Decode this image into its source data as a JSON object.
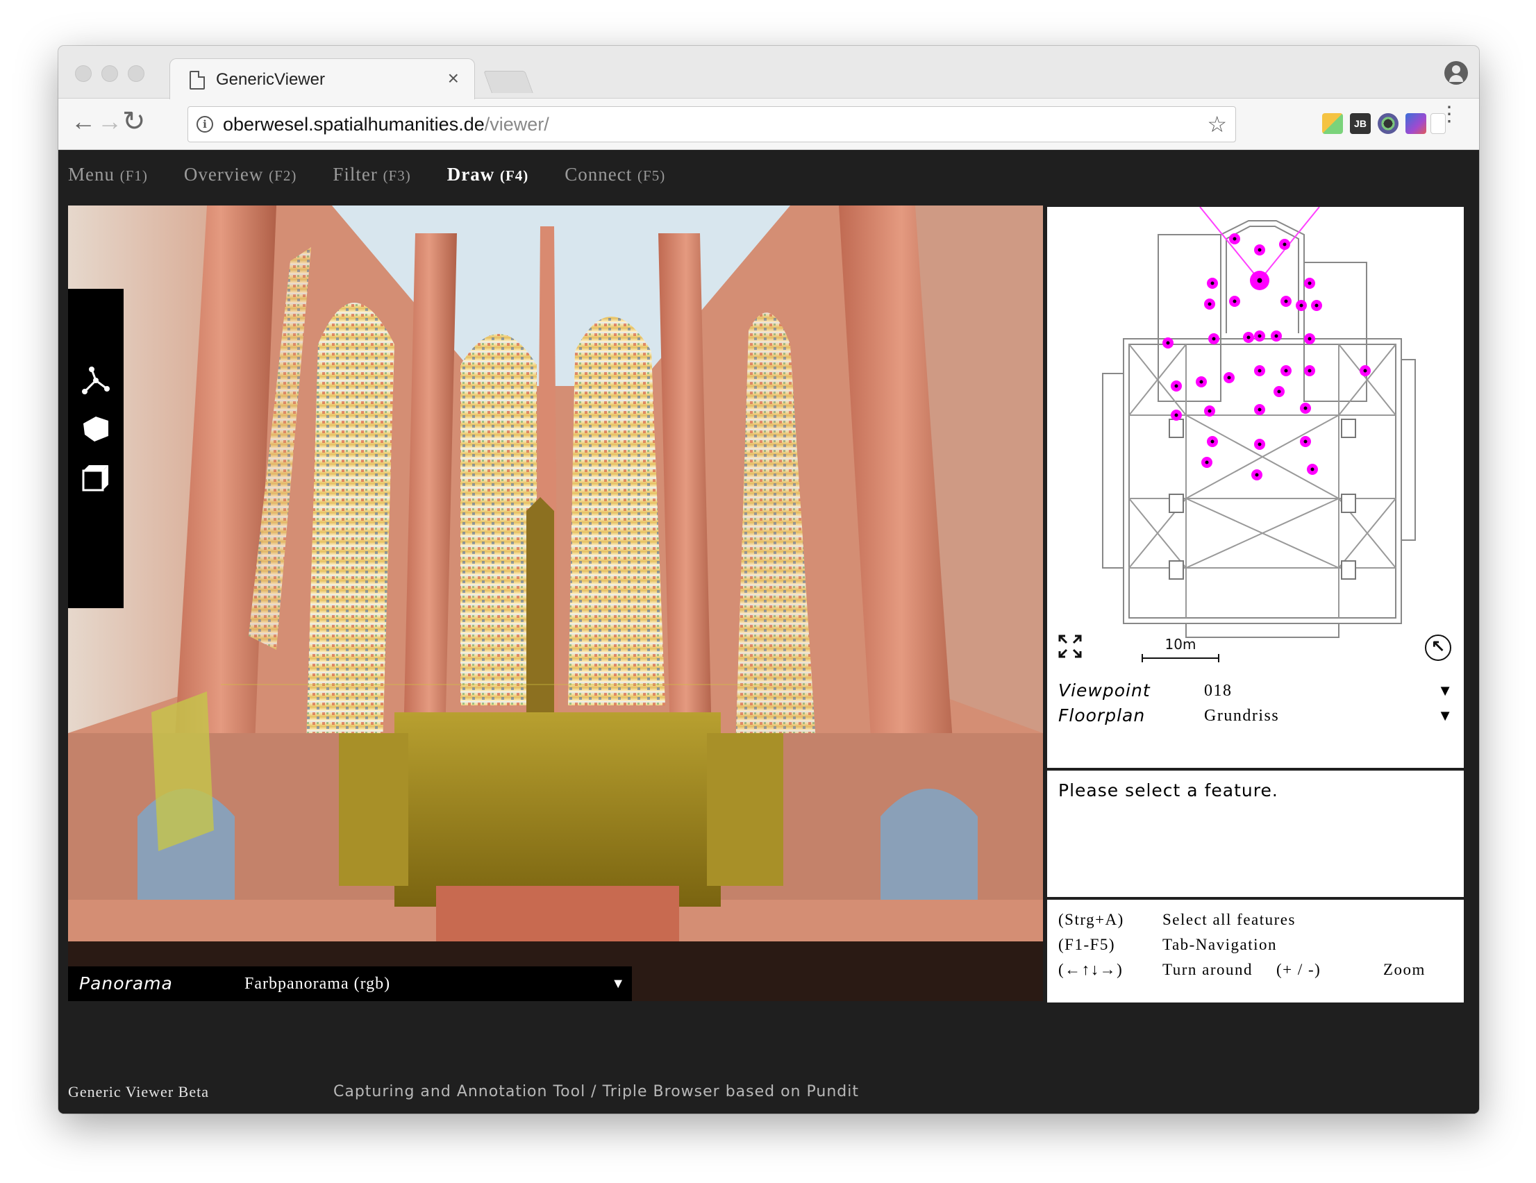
{
  "browser": {
    "tab_title": "GenericViewer",
    "tab_close": "×",
    "url_host": "oberwesel.spatialhumanities.de",
    "url_path": "/viewer/",
    "back": "←",
    "forward": "→",
    "reload": "↻",
    "star": "☆",
    "menu": "⋮",
    "info": "i"
  },
  "nav": {
    "items": [
      {
        "label": "Menu",
        "key": "(F1)"
      },
      {
        "label": "Overview",
        "key": "(F2)"
      },
      {
        "label": "Filter",
        "key": "(F3)"
      },
      {
        "label": "Draw",
        "key": "(F4)"
      },
      {
        "label": "Connect",
        "key": "(F5)"
      }
    ],
    "active": "Draw"
  },
  "panorama": {
    "label": "Panorama",
    "value": "Farbpanorama (rgb)",
    "caret": "▼",
    "tools": [
      "polyline-icon",
      "polygon-icon",
      "box-icon"
    ]
  },
  "map": {
    "scale_label": "10m",
    "marker_color": "#ff00ff",
    "viewpoints": 38
  },
  "meta": {
    "viewpoint_label": "Viewpoint",
    "viewpoint_value": "018",
    "floorplan_label": "Floorplan",
    "floorplan_value": "Grundriss",
    "caret": "▼"
  },
  "feature": {
    "message": "Please select a feature."
  },
  "shortcuts": [
    {
      "key": "(Strg+A)",
      "desc": "Select all features"
    },
    {
      "key": "(F1-F5)",
      "desc": "Tab-Navigation"
    },
    {
      "key": "(←↑↓→)",
      "desc": "Turn around",
      "key2": "(+ / -)",
      "desc2": "Zoom"
    }
  ],
  "footer": {
    "brand": "Generic Viewer Beta",
    "description": "Capturing and Annotation Tool / Triple Browser based on Pundit"
  },
  "colors": {
    "app_bg": "#1f1f1f",
    "nav_inactive": "#9a9a9a",
    "nav_active": "#ffffff",
    "marker": "#ff00ff"
  }
}
